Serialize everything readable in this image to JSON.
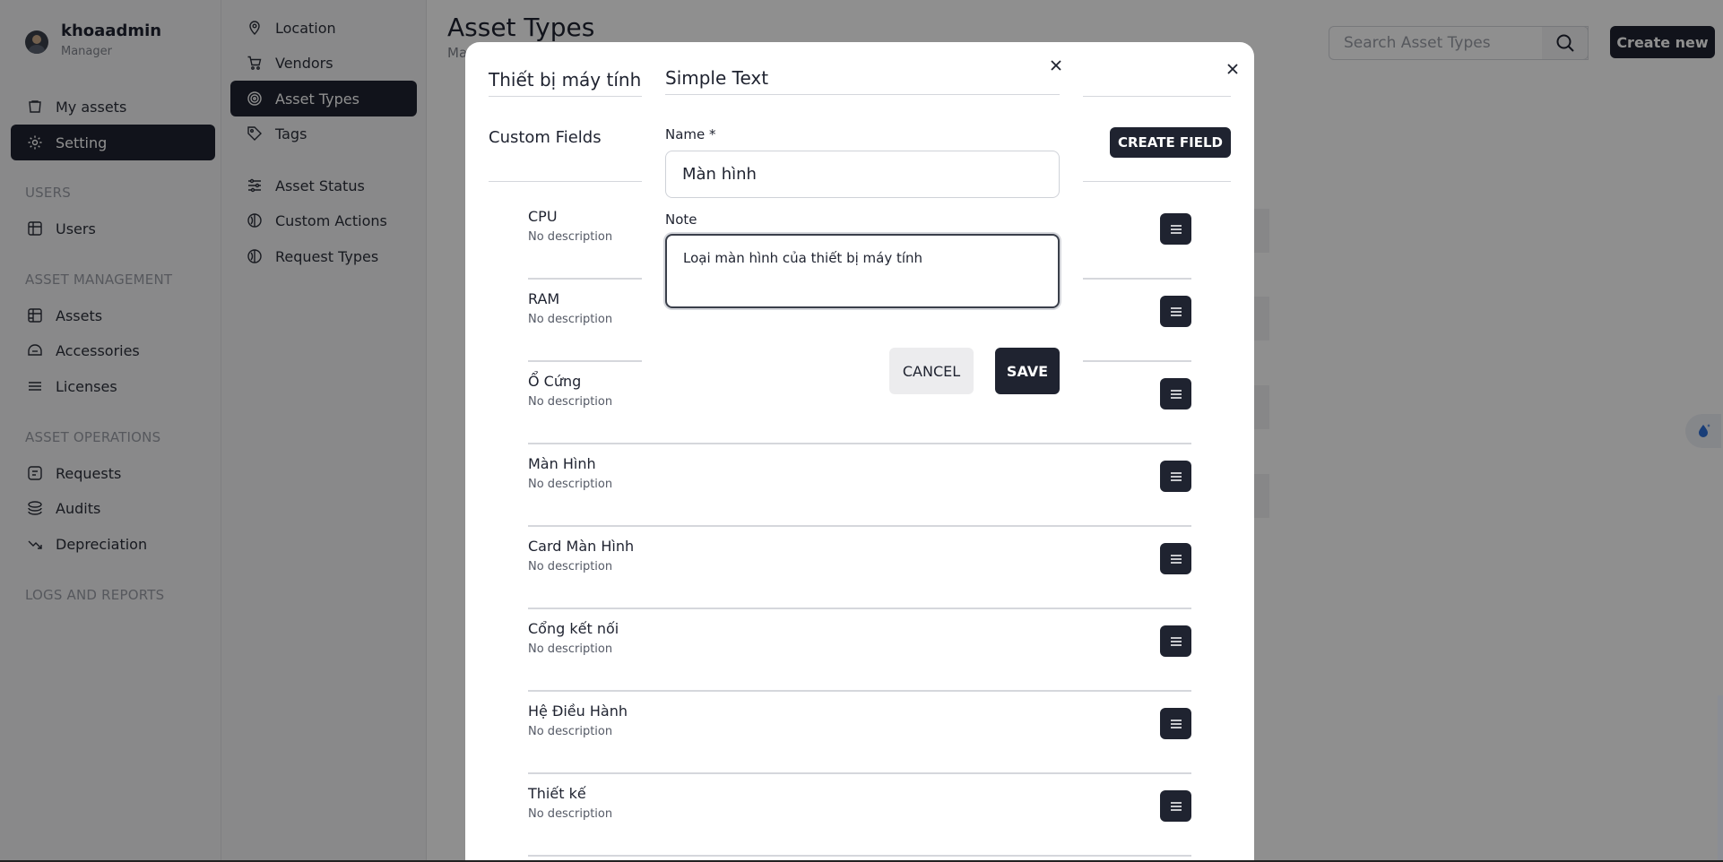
{
  "user": {
    "name": "khoaadmin",
    "role": "Manager"
  },
  "sidebar": {
    "items": [
      {
        "label": "My assets"
      },
      {
        "label": "Setting"
      }
    ],
    "sections": [
      {
        "title": "USERS",
        "items": [
          {
            "label": "Users"
          }
        ]
      },
      {
        "title": "ASSET MANAGEMENT",
        "items": [
          {
            "label": "Assets"
          },
          {
            "label": "Accessories"
          },
          {
            "label": "Licenses"
          }
        ]
      },
      {
        "title": "ASSET OPERATIONS",
        "items": [
          {
            "label": "Requests"
          },
          {
            "label": "Audits"
          },
          {
            "label": "Depreciation"
          }
        ]
      },
      {
        "title": "LOGS AND REPORTS"
      }
    ]
  },
  "subnav": {
    "items": [
      {
        "label": "Location"
      },
      {
        "label": "Vendors"
      },
      {
        "label": "Asset Types"
      },
      {
        "label": "Tags"
      },
      {
        "label": "Asset Status"
      },
      {
        "label": "Custom Actions"
      },
      {
        "label": "Request Types"
      }
    ]
  },
  "main": {
    "title": "Asset Types",
    "subtitle": "Ma",
    "search_placeholder": "Search Asset Types",
    "create_new_label": "Create new"
  },
  "panel": {
    "title": "Thiết bị máy tính",
    "custom_fields_title": "Custom Fields",
    "create_field_label": "CREATE FIELD",
    "fields": [
      {
        "name": "CPU",
        "description": "No description"
      },
      {
        "name": "RAM",
        "description": "No description"
      },
      {
        "name": "Ổ Cứng",
        "description": "No description"
      },
      {
        "name": "Màn Hình",
        "description": "No description"
      },
      {
        "name": "Card Màn Hình",
        "description": "No description"
      },
      {
        "name": "Cổng kết nối",
        "description": "No description"
      },
      {
        "name": "Hệ Điều Hành",
        "description": "No description"
      },
      {
        "name": "Thiết kế",
        "description": "No description"
      }
    ]
  },
  "dialog": {
    "title": "Simple Text",
    "name_label": "Name *",
    "name_value": "Màn hình",
    "note_label": "Note",
    "note_value": "Loại màn hình của thiết bị máy tính",
    "cancel_label": "CANCEL",
    "save_label": "SAVE"
  },
  "colors": {
    "primary": "#1f2330",
    "overlay": "rgba(0,0,0,0.44)"
  },
  "icons": {
    "my_assets": "box-icon",
    "setting": "gear-icon",
    "users": "users-icon",
    "assets": "grid-icon",
    "accessories": "accessory-icon",
    "licenses": "list-icon",
    "requests": "request-icon",
    "audits": "stack-icon",
    "depreciation": "trend-down-icon"
  }
}
